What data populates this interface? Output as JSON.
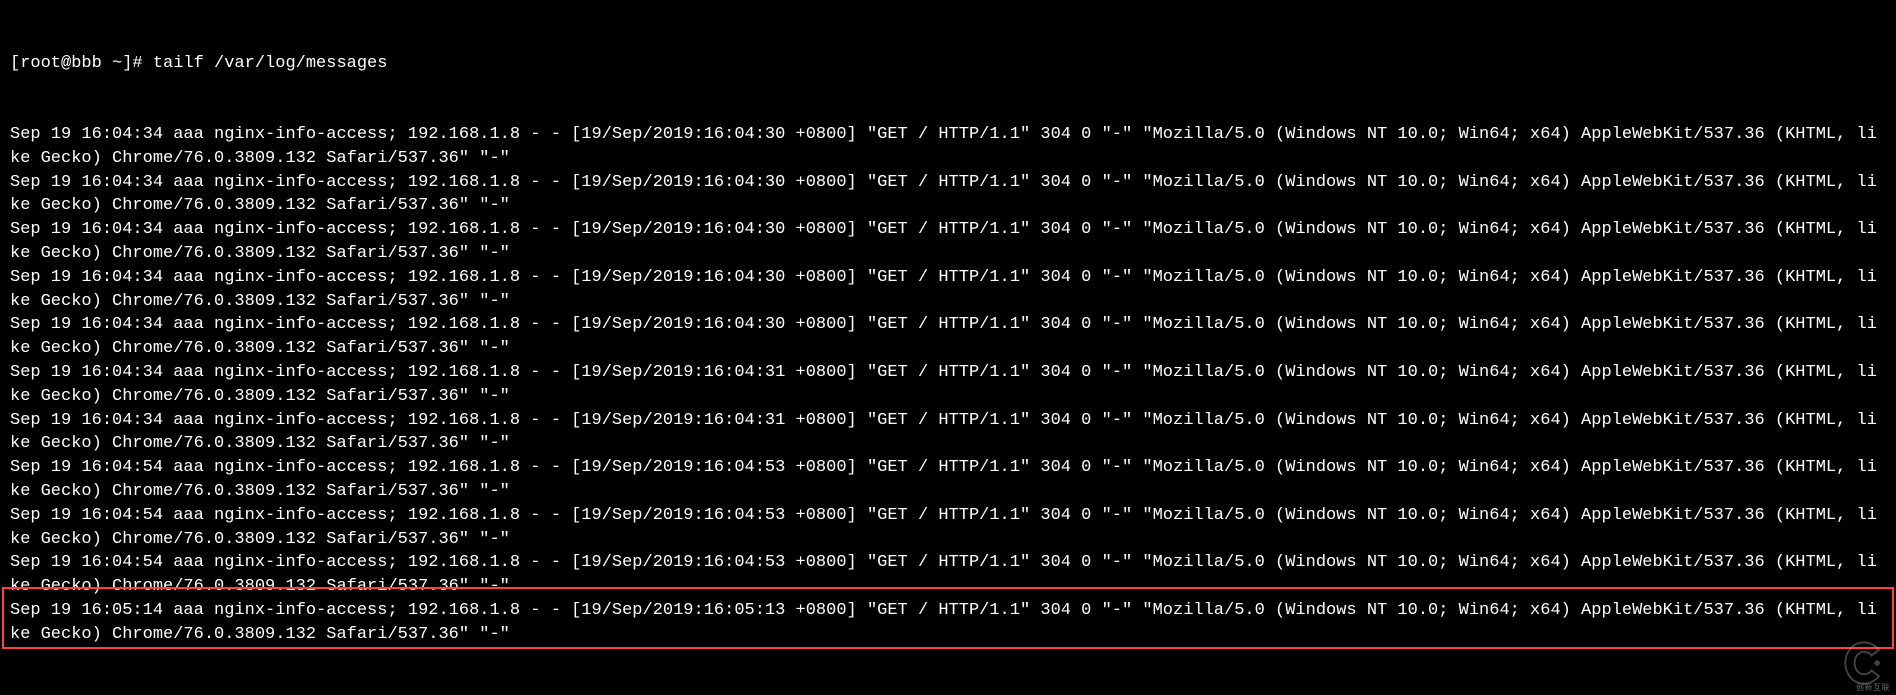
{
  "prompt": "[root@bbb ~]# tailf /var/log/messages",
  "log_entries": [
    "Sep 19 16:04:34 aaa nginx-info-access; 192.168.1.8 - - [19/Sep/2019:16:04:30 +0800] \"GET / HTTP/1.1\" 304 0 \"-\" \"Mozilla/5.0 (Windows NT 10.0; Win64; x64) AppleWebKit/537.36 (KHTML, like Gecko) Chrome/76.0.3809.132 Safari/537.36\" \"-\"",
    "Sep 19 16:04:34 aaa nginx-info-access; 192.168.1.8 - - [19/Sep/2019:16:04:30 +0800] \"GET / HTTP/1.1\" 304 0 \"-\" \"Mozilla/5.0 (Windows NT 10.0; Win64; x64) AppleWebKit/537.36 (KHTML, like Gecko) Chrome/76.0.3809.132 Safari/537.36\" \"-\"",
    "Sep 19 16:04:34 aaa nginx-info-access; 192.168.1.8 - - [19/Sep/2019:16:04:30 +0800] \"GET / HTTP/1.1\" 304 0 \"-\" \"Mozilla/5.0 (Windows NT 10.0; Win64; x64) AppleWebKit/537.36 (KHTML, like Gecko) Chrome/76.0.3809.132 Safari/537.36\" \"-\"",
    "Sep 19 16:04:34 aaa nginx-info-access; 192.168.1.8 - - [19/Sep/2019:16:04:30 +0800] \"GET / HTTP/1.1\" 304 0 \"-\" \"Mozilla/5.0 (Windows NT 10.0; Win64; x64) AppleWebKit/537.36 (KHTML, like Gecko) Chrome/76.0.3809.132 Safari/537.36\" \"-\"",
    "Sep 19 16:04:34 aaa nginx-info-access; 192.168.1.8 - - [19/Sep/2019:16:04:30 +0800] \"GET / HTTP/1.1\" 304 0 \"-\" \"Mozilla/5.0 (Windows NT 10.0; Win64; x64) AppleWebKit/537.36 (KHTML, like Gecko) Chrome/76.0.3809.132 Safari/537.36\" \"-\"",
    "Sep 19 16:04:34 aaa nginx-info-access; 192.168.1.8 - - [19/Sep/2019:16:04:31 +0800] \"GET / HTTP/1.1\" 304 0 \"-\" \"Mozilla/5.0 (Windows NT 10.0; Win64; x64) AppleWebKit/537.36 (KHTML, like Gecko) Chrome/76.0.3809.132 Safari/537.36\" \"-\"",
    "Sep 19 16:04:34 aaa nginx-info-access; 192.168.1.8 - - [19/Sep/2019:16:04:31 +0800] \"GET / HTTP/1.1\" 304 0 \"-\" \"Mozilla/5.0 (Windows NT 10.0; Win64; x64) AppleWebKit/537.36 (KHTML, like Gecko) Chrome/76.0.3809.132 Safari/537.36\" \"-\"",
    "Sep 19 16:04:54 aaa nginx-info-access; 192.168.1.8 - - [19/Sep/2019:16:04:53 +0800] \"GET / HTTP/1.1\" 304 0 \"-\" \"Mozilla/5.0 (Windows NT 10.0; Win64; x64) AppleWebKit/537.36 (KHTML, like Gecko) Chrome/76.0.3809.132 Safari/537.36\" \"-\"",
    "Sep 19 16:04:54 aaa nginx-info-access; 192.168.1.8 - - [19/Sep/2019:16:04:53 +0800] \"GET / HTTP/1.1\" 304 0 \"-\" \"Mozilla/5.0 (Windows NT 10.0; Win64; x64) AppleWebKit/537.36 (KHTML, like Gecko) Chrome/76.0.3809.132 Safari/537.36\" \"-\"",
    "Sep 19 16:04:54 aaa nginx-info-access; 192.168.1.8 - - [19/Sep/2019:16:04:53 +0800] \"GET / HTTP/1.1\" 304 0 \"-\" \"Mozilla/5.0 (Windows NT 10.0; Win64; x64) AppleWebKit/537.36 (KHTML, like Gecko) Chrome/76.0.3809.132 Safari/537.36\" \"-\""
  ],
  "highlighted_entry": "Sep 19 16:05:14 aaa nginx-info-access; 192.168.1.8 - - [19/Sep/2019:16:05:13 +0800] \"GET / HTTP/1.1\" 304 0 \"-\" \"Mozilla/5.0 (Windows NT 10.0; Win64; x64) AppleWebKit/537.36 (KHTML, like Gecko) Chrome/76.0.3809.132 Safari/537.36\" \"-\"",
  "watermark_label": "创新互联"
}
